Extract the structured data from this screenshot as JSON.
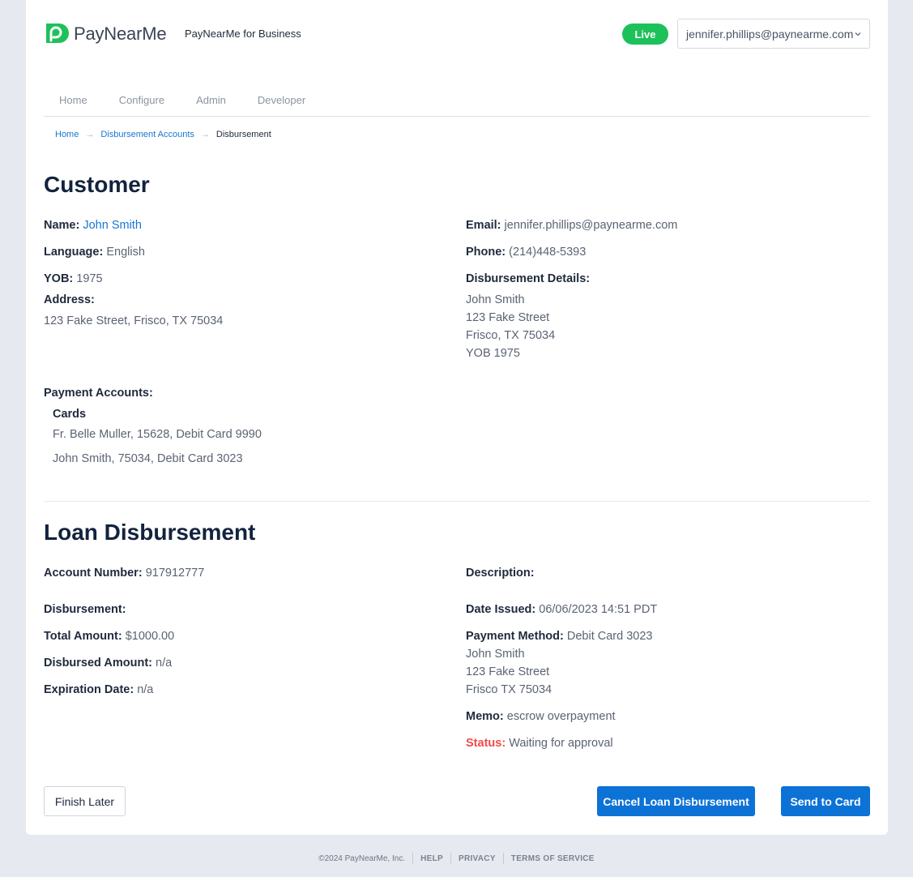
{
  "header": {
    "brand": "PayNearMe",
    "subtitle": "PayNearMe for Business",
    "env_badge": "Live",
    "user_email": "jennifer.phillips@paynearme.com",
    "brand_color": "#1dc15a"
  },
  "nav": {
    "items": [
      {
        "label": "Home"
      },
      {
        "label": "Configure"
      },
      {
        "label": "Admin"
      },
      {
        "label": "Developer"
      }
    ]
  },
  "breadcrumb": {
    "items": [
      "Home",
      "Disbursement Accounts",
      "Disbursement"
    ]
  },
  "customer": {
    "title": "Customer",
    "name_label": "Name:",
    "name": "John Smith",
    "language_label": "Language:",
    "language": "English",
    "yob_label": "YOB:",
    "yob": "1975",
    "address_label": "Address:",
    "address": "123 Fake Street,  Frisco, TX 75034",
    "email_label": "Email:",
    "email": "jennifer.phillips@paynearme.com",
    "phone_label": "Phone:",
    "phone": "(214)448-5393",
    "details_label": "Disbursement Details:",
    "details": [
      "John Smith",
      "123 Fake Street",
      "Frisco, TX 75034",
      "YOB 1975"
    ],
    "payment_accounts_label": "Payment Accounts:",
    "cards_label": "Cards",
    "cards": [
      "Fr. Belle Muller, 15628, Debit Card 9990",
      "John Smith, 75034, Debit Card 3023"
    ]
  },
  "loan": {
    "title": "Loan Disbursement",
    "account_label": "Account Number:",
    "account": "917912777",
    "disbursement_label": "Disbursement:",
    "total_label": "Total Amount:",
    "total": "$1000.00",
    "disbursed_label": "Disbursed Amount:",
    "disbursed": "n/a",
    "expiration_label": "Expiration Date:",
    "expiration": "n/a",
    "description_label": "Description:",
    "date_label": "Date Issued:",
    "date": "06/06/2023 14:51 PDT",
    "method_label": "Payment Method:",
    "method": "Debit Card 3023",
    "method_lines": [
      "John Smith",
      "123 Fake Street",
      "Frisco TX 75034"
    ],
    "memo_label": "Memo:",
    "memo": "escrow overpayment",
    "status_label": "Status:",
    "status": "Waiting for approval",
    "status_color": "#f24b4b"
  },
  "actions": {
    "finish_later": "Finish Later",
    "cancel": "Cancel Loan Disbursement",
    "send": "Send to Card"
  },
  "footer": {
    "copyright": "©2024 PayNearMe, Inc.",
    "help": "HELP",
    "privacy": "PRIVACY",
    "terms": "TERMS OF SERVICE"
  }
}
